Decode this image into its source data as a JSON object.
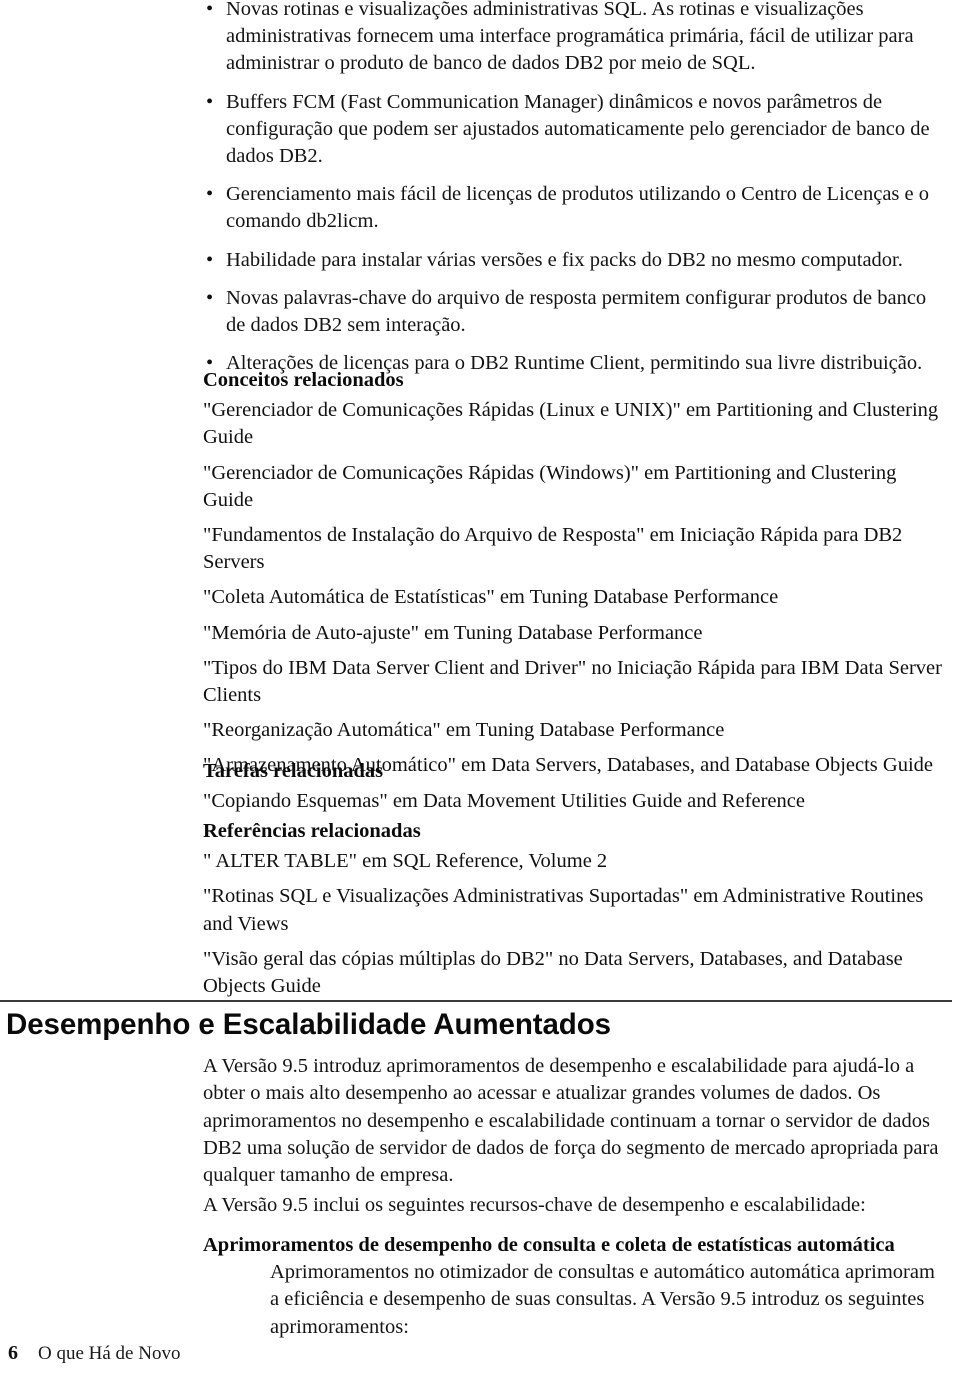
{
  "document": {
    "language": "pt-BR",
    "page_number": "6",
    "footer_label": "O que Há de Novo",
    "bullet_glyph": "•"
  },
  "feature_bullets": [
    "Novas rotinas e visualizações administrativas SQL. As rotinas e visualizações administrativas fornecem uma interface programática primária, fácil de utilizar para administrar o produto de banco de dados DB2 por meio de SQL.",
    "Buffers FCM (Fast Communication Manager) dinâmicos e novos parâmetros de configuração que podem ser ajustados automaticamente pelo gerenciador de banco de dados DB2.",
    "Gerenciamento mais fácil de licenças de produtos utilizando o Centro de Licenças e o comando db2licm.",
    "Habilidade para instalar várias versões e fix packs do DB2 no mesmo computador.",
    "Novas palavras-chave do arquivo de resposta permitem configurar produtos de banco de dados DB2 sem interação.",
    "Alterações de licenças para o DB2 Runtime Client, permitindo sua livre distribuição."
  ],
  "related_concepts": {
    "heading": "Conceitos relacionados",
    "entries": [
      "\"Gerenciador de Comunicações Rápidas (Linux e UNIX)\" em Partitioning and Clustering Guide",
      "\"Gerenciador de Comunicações Rápidas (Windows)\" em Partitioning and Clustering Guide",
      "\"Fundamentos de Instalação do Arquivo de Resposta\" em Iniciação Rápida para DB2 Servers",
      "\"Coleta Automática de Estatísticas\" em Tuning Database Performance",
      "\"Memória de Auto-ajuste\" em Tuning Database Performance",
      "\"Tipos do IBM Data Server Client and Driver\" no Iniciação Rápida para IBM Data Server Clients",
      "\"Reorganização Automática\" em Tuning Database Performance",
      "\"Armazenamento Automático\" em Data Servers, Databases, and Database Objects Guide"
    ]
  },
  "related_tasks": {
    "heading": "Tarefas relacionadas",
    "entries": [
      "\"Copiando Esquemas\" em Data Movement Utilities Guide and Reference"
    ]
  },
  "related_references": {
    "heading": "Referências relacionadas",
    "entries": [
      "\" ALTER TABLE\" em SQL Reference, Volume 2",
      "\"Rotinas SQL e Visualizações Administrativas Suportadas\" em Administrative Routines and Views",
      "\"Visão geral das cópias múltiplas do DB2\" no Data Servers, Databases, and Database Objects Guide"
    ]
  },
  "section": {
    "title": "Desempenho e Escalabilidade Aumentados",
    "intro_paragraph": "A Versão 9.5 introduz aprimoramentos de desempenho e escalabilidade para ajudá-lo a obter o mais alto desempenho ao acessar e atualizar grandes volumes de dados. Os aprimoramentos no desempenho e escalabilidade continuam a tornar o servidor de dados DB2 uma solução de servidor de dados de força do segmento de mercado apropriada para qualquer tamanho de empresa.",
    "lead_in_paragraph": "A Versão 9.5 inclui os seguintes recursos-chave de desempenho e escalabilidade:",
    "definitions": [
      {
        "term": "Aprimoramentos de desempenho de consulta e coleta de estatísticas automática",
        "body": "Aprimoramentos no otimizador de consultas e automático automática aprimoram a eficiência e desempenho de suas consultas. A Versão 9.5 introduz os seguintes aprimoramentos:"
      }
    ]
  }
}
